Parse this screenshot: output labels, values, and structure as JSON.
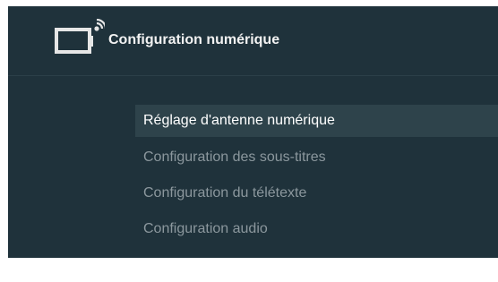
{
  "header": {
    "title": "Configuration numérique",
    "icon": "tv-signal-icon"
  },
  "menu": {
    "items": [
      {
        "label": "Réglage d'antenne numérique",
        "selected": true
      },
      {
        "label": "Configuration des sous-titres",
        "selected": false
      },
      {
        "label": "Configuration du télétexte",
        "selected": false
      },
      {
        "label": "Configuration audio",
        "selected": false
      }
    ]
  },
  "colors": {
    "background": "#1f323b",
    "selected_row": "#2e434b",
    "selected_text": "#ffffff",
    "unselected_text": "#8b979d"
  }
}
